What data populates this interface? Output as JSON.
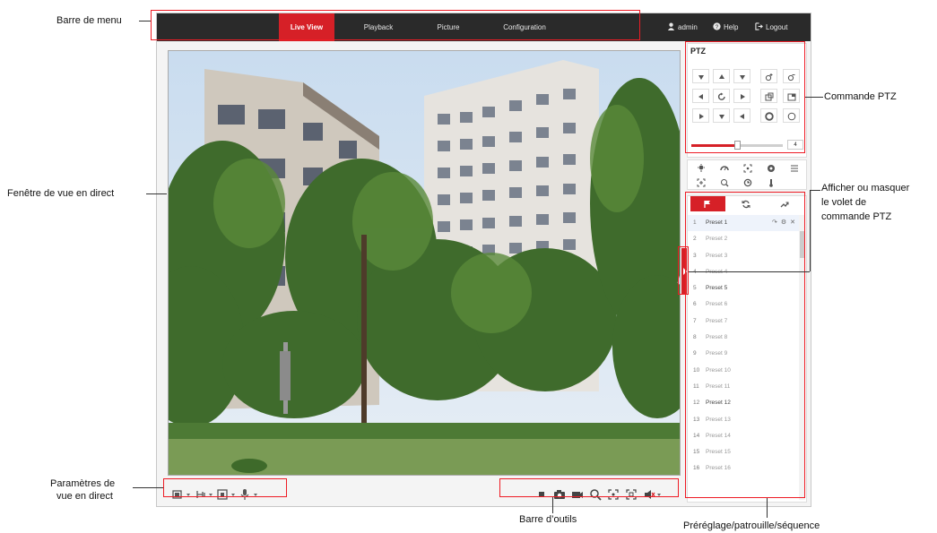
{
  "menu": {
    "tabs": [
      {
        "label": "Live View",
        "active": true
      },
      {
        "label": "Playback",
        "active": false
      },
      {
        "label": "Picture",
        "active": false
      },
      {
        "label": "Configuration",
        "active": false
      }
    ],
    "user": "admin",
    "help": "Help",
    "logout": "Logout"
  },
  "ptz": {
    "title": "PTZ",
    "speed_value": "4",
    "speed_level_fraction": 0.5
  },
  "presets": [
    {
      "num": "1",
      "name": "Preset 1",
      "defined": true
    },
    {
      "num": "2",
      "name": "Preset 2",
      "defined": false
    },
    {
      "num": "3",
      "name": "Preset 3",
      "defined": false
    },
    {
      "num": "4",
      "name": "Preset 4",
      "defined": false
    },
    {
      "num": "5",
      "name": "Preset 5",
      "defined": true
    },
    {
      "num": "6",
      "name": "Preset 6",
      "defined": false
    },
    {
      "num": "7",
      "name": "Preset 7",
      "defined": false
    },
    {
      "num": "8",
      "name": "Preset 8",
      "defined": false
    },
    {
      "num": "9",
      "name": "Preset 9",
      "defined": false
    },
    {
      "num": "10",
      "name": "Preset 10",
      "defined": false
    },
    {
      "num": "11",
      "name": "Preset 11",
      "defined": false
    },
    {
      "num": "12",
      "name": "Preset 12",
      "defined": true
    },
    {
      "num": "13",
      "name": "Preset 13",
      "defined": false
    },
    {
      "num": "14",
      "name": "Preset 14",
      "defined": false
    },
    {
      "num": "15",
      "name": "Preset 15",
      "defined": false
    },
    {
      "num": "16",
      "name": "Preset 16",
      "defined": false
    }
  ],
  "annotations": {
    "menu_bar": "Barre de menu",
    "live_window": "Fenêtre de vue en direct",
    "live_params_line1": "Paramètres de",
    "live_params_line2": "vue en direct",
    "toolbar": "Barre d’outils",
    "ptz_control": "Commande PTZ",
    "toggle_line1": "Afficher ou masquer",
    "toggle_line2": "le volet de",
    "toggle_line3": "commande PTZ",
    "preset_patrol": "Préréglage/patrouille/séquence"
  },
  "colors": {
    "accent": "#d62027",
    "menubar": "#2a2a2a",
    "callout": "#ee1c25"
  }
}
